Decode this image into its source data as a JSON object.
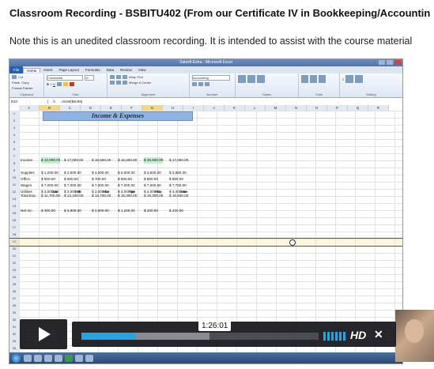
{
  "page": {
    "title": "Classroom Recording - BSBITU402 (From our Certificate IV in Bookkeeping/Accountin",
    "note": "Note this is an unedited classroom recording. It is intended to assist with the course material"
  },
  "excel": {
    "window_title": "Salesfi-Extra - Microsoft Excel",
    "tabs": [
      "File",
      "Home",
      "Insert",
      "Page Layout",
      "Formulas",
      "Data",
      "Review",
      "View"
    ],
    "active_tab": "Home",
    "ribbon": {
      "groups": [
        "Clipboard",
        "Font",
        "Alignment",
        "Number",
        "Styles",
        "Cells",
        "Editing"
      ],
      "font_name": "Constantia",
      "font_size": "11",
      "number_format": "Accounting",
      "wrap_text": "Wrap Text",
      "merge": "Merge & Center",
      "cut": "Cut",
      "copy": "Copy",
      "format_painter": "Format Painter",
      "paste": "Paste"
    },
    "name_box": "B10",
    "formula": "=SUM(B6:B9)",
    "columns": [
      "A",
      "B",
      "C",
      "D",
      "E",
      "F",
      "G",
      "H",
      "I",
      "J",
      "K",
      "L",
      "M",
      "N",
      "O",
      "P",
      "Q",
      "R"
    ],
    "sheet_title": "Income & Expenses",
    "months": [
      "Jan",
      "Feb",
      "Mar",
      "Apr",
      "May",
      "June"
    ],
    "rows": [
      {
        "label": "Income",
        "values": [
          "$ 12,000.00",
          "$ 17,000.00",
          "$ 18,500.00",
          "$ 16,500.00",
          "$ 25,500.00",
          "$ 17,050.00"
        ]
      },
      {
        "label": "Supplies",
        "values": [
          "$ 1,200.00",
          "$ 2,500.00",
          "$ 3,000.00",
          "$ 5,500.00",
          "$ 3,500.00",
          "$ 3,850.00"
        ]
      },
      {
        "label": "Office",
        "values": [
          "$ 500.00",
          "$ 600.00",
          "$ 700.00",
          "$ 600.00",
          "$ 800.00",
          "$ 880.00"
        ]
      },
      {
        "label": "Wages",
        "values": [
          "$ 7,000.00",
          "$ 7,000.00",
          "$ 7,000.00",
          "$ 7,000.00",
          "$ 7,000.00",
          "$ 7,700.00"
        ]
      },
      {
        "label": "Utilities",
        "values": [
          "$ 3,000.00",
          "$ 3,000.00",
          "$ 3,000.00",
          "$ 4,000.00",
          "$ 4,000.00",
          "$ 4,400.00"
        ]
      },
      {
        "label": "Total Exp",
        "values": [
          "$ 11,700.00",
          "$ 13,100.00",
          "$ 13,700.00",
          "$ 15,300.00",
          "$ 15,300.00",
          "$ 16,830.00"
        ]
      },
      {
        "label": "Net Inc.",
        "values": [
          "$ 300.00",
          "$ 3,900.00",
          "$ 4,800.00",
          "$ 1,200.00",
          "$ 200.00",
          "$ 220.00"
        ]
      }
    ]
  },
  "player": {
    "time": "1:26:01",
    "progress_played": 0.23,
    "progress_loaded": 0.54,
    "hd_label": "HD"
  }
}
